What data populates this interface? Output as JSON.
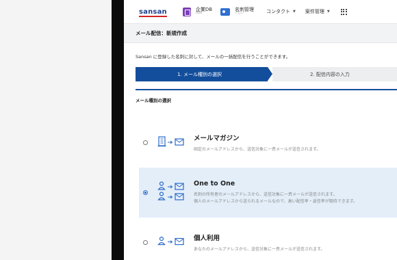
{
  "header": {
    "logo": "sansan",
    "nav": [
      {
        "title": "企業DB",
        "sub": "DBB"
      },
      {
        "title": "名刺管理",
        "sub": "くむい"
      }
    ],
    "menus": [
      {
        "label": "コンタクト",
        "caret": "▼"
      },
      {
        "label": "案件管理",
        "caret": "▼"
      }
    ]
  },
  "page": {
    "title": "メール配信：新規作成",
    "intro": "Sansan に登録した名刺に対して、メールの一括配信を行うことができます。"
  },
  "stepper": {
    "steps": [
      "1. メール種別の選択",
      "2. 配信内容の入力"
    ],
    "active_index": 0
  },
  "section": {
    "heading": "メール種別の選択"
  },
  "options": [
    {
      "title": "メールマガジン",
      "desc": [
        "固定のメールアドレスから、送信対象に一斉メールが送信されます。"
      ],
      "selected": false,
      "icon": "building-to-mail-icon"
    },
    {
      "title": "One to One",
      "desc": [
        "名刺の所有者のメールアドレスから、送信対象に一斉メールが送信されます。",
        "個人のメールアドレスから送られるメールなので、高い配信率・返信率が期待できます。"
      ],
      "selected": true,
      "icon": "people-to-mail-icon"
    },
    {
      "title": "個人利用",
      "desc": [
        "あなたのメールアドレスから、送信対象に一斉メールが送信されます。"
      ],
      "selected": false,
      "icon": "person-to-mail-icon"
    }
  ],
  "colors": {
    "primary": "#134e9c",
    "selected_bg": "#e3eef9",
    "logo_accent": "#d32323"
  }
}
